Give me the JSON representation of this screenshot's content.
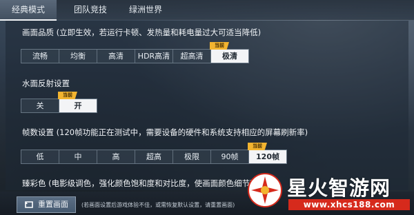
{
  "tabs": [
    {
      "label": "经典模式",
      "active": true
    },
    {
      "label": "团队竞技",
      "active": false
    },
    {
      "label": "绿洲世界",
      "active": false
    }
  ],
  "settings": {
    "quality": {
      "title": "画面品质 (立即生效，若运行卡顿、发热量和耗电量过大可适当降低)",
      "options": [
        "流畅",
        "均衡",
        "高清",
        "HDR高清",
        "超高清",
        "极清"
      ],
      "selected": "极清",
      "badge": "当前"
    },
    "water": {
      "title": "水面反射设置",
      "options": [
        "关",
        "开"
      ],
      "selected": "开",
      "badge": "当前"
    },
    "fps": {
      "title": "帧数设置 (120帧功能正在测试中，需要设备的硬件和系统支持相应的屏幕刷新率)",
      "options": [
        "低",
        "中",
        "高",
        "超高",
        "极限",
        "90帧",
        "120帧"
      ],
      "selected": "120帧",
      "badge": "当前"
    },
    "color": {
      "title": "臻彩色 (电影级调色，强化颜色饱和度和对比度，使画面颜色细节更丰富)"
    }
  },
  "footer": {
    "reset_label": "重置画面",
    "hint": "(若画面设置后游戏体验不佳，或需恢复默认设置，请重置画面)"
  },
  "watermark": {
    "title": "星火智游网",
    "url": "www.xhcs188.com"
  },
  "colors": {
    "accent_badge": "#f2b430",
    "watermark_red": "#d62a1c"
  }
}
